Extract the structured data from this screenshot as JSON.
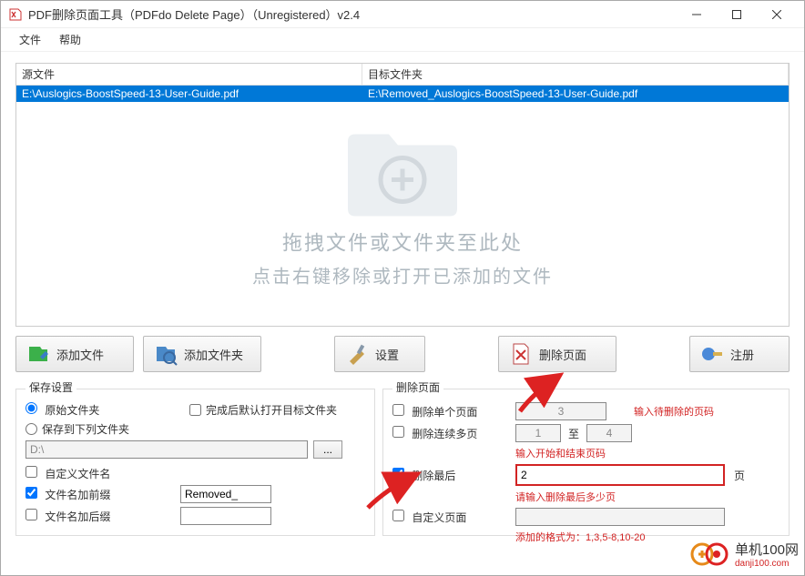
{
  "window": {
    "title": "PDF删除页面工具（PDFdo Delete Page）（Unregistered）v2.4"
  },
  "menu": {
    "file": "文件",
    "help": "帮助"
  },
  "table": {
    "col1": "源文件",
    "col2": "目标文件夹",
    "row_src": "E:\\Auslogics-BoostSpeed-13-User-Guide.pdf",
    "row_dst": "E:\\Removed_Auslogics-BoostSpeed-13-User-Guide.pdf",
    "hint1": "拖拽文件或文件夹至此处",
    "hint2": "点击右键移除或打开已添加的文件"
  },
  "toolbar": {
    "add_file": "添加文件",
    "add_folder": "添加文件夹",
    "settings": "设置",
    "delete": "删除页面",
    "register": "注册"
  },
  "save": {
    "legend": "保存设置",
    "orig_folder": "原始文件夹",
    "custom_folder": "保存到下列文件夹",
    "open_after": "完成后默认打开目标文件夹",
    "path": "D:\\",
    "browse": "...",
    "custom_name": "自定义文件名",
    "prefix": "文件名加前缀",
    "prefix_val": "Removed_",
    "suffix": "文件名加后缀"
  },
  "del": {
    "legend": "删除页面",
    "single": "删除单个页面",
    "single_val": "3",
    "single_hint": "输入待删除的页码",
    "range": "删除连续多页",
    "range_from": "1",
    "range_mid": "至",
    "range_to": "4",
    "range_hint": "输入开始和结束页码",
    "last": "删除最后",
    "last_val": "2",
    "last_unit": "页",
    "last_hint": "请输入删除最后多少页",
    "custom": "自定义页面",
    "custom_hint": "添加的格式为：1,3,5-8,10-20"
  },
  "watermark": {
    "name": "单机100网",
    "url": "danji100.com"
  }
}
